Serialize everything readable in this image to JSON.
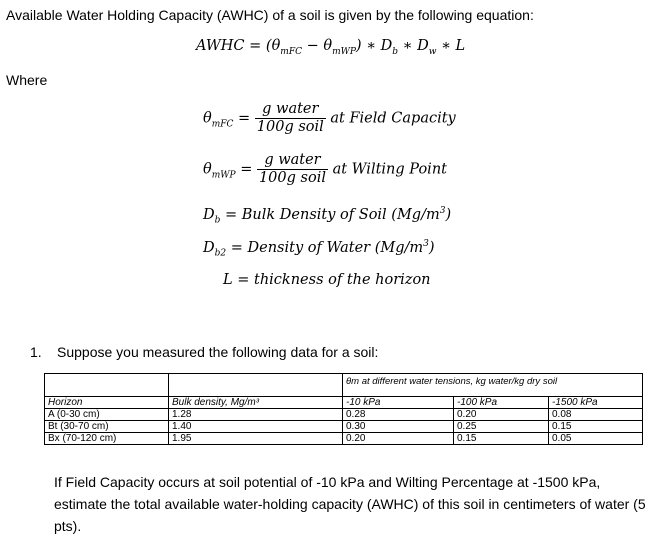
{
  "intro": "Available Water Holding Capacity (AWHC) of a soil is given by the following equation:",
  "main_equation": {
    "lhs": "AWHC",
    "rhs_open": "(θ",
    "sub_fc": "mFC",
    "minus": " − θ",
    "sub_wp": "mWP",
    "rhs_close": ") ∗ D",
    "sub_b": "b",
    "times_w": " ∗ D",
    "sub_w": "w",
    "times_l": " ∗ L"
  },
  "where_label": "Where",
  "definitions": {
    "theta_fc": {
      "symbol": "θ",
      "sub": "mFC",
      "numerator": "g water",
      "denominator": "100g soil",
      "suffix": "at Field Capacity"
    },
    "theta_wp": {
      "symbol": "θ",
      "sub": "mWP",
      "numerator": "g water",
      "denominator": "100g soil",
      "suffix": "at Wilting Point"
    },
    "db": {
      "symbol": "D",
      "sub": "b",
      "text": " = Bulk Density of Soil (Mg/m",
      "sup": "3",
      "close": ")"
    },
    "db2": {
      "symbol": "D",
      "sub": "b2",
      "text": " = Density of Water (Mg/m",
      "sup": "3",
      "close": ")"
    },
    "l": {
      "text": "L = thickness of the horizon"
    }
  },
  "question": {
    "number": "1.",
    "text": "Suppose you measured the following data for a soil:"
  },
  "table": {
    "group_header": "θm at different water tensions, kg water/kg dry soil",
    "headers": [
      "Horizon",
      "Bulk density, Mg/m³",
      "-10 kPa",
      "-100 kPa",
      "-1500 kPa"
    ],
    "rows": [
      [
        "A (0-30 cm)",
        "1.28",
        "0.28",
        "0.20",
        "0.08"
      ],
      [
        "Bt (30-70 cm)",
        "1.40",
        "0.30",
        "0.25",
        "0.15"
      ],
      [
        "Bx (70-120 cm)",
        "1.95",
        "0.20",
        "0.15",
        "0.05"
      ]
    ]
  },
  "final_question": "If Field Capacity occurs at soil potential of -10 kPa and Wilting Percentage at -1500 kPa, estimate the total available water-holding capacity (AWHC) of this soil in centimeters of water (5 pts)."
}
